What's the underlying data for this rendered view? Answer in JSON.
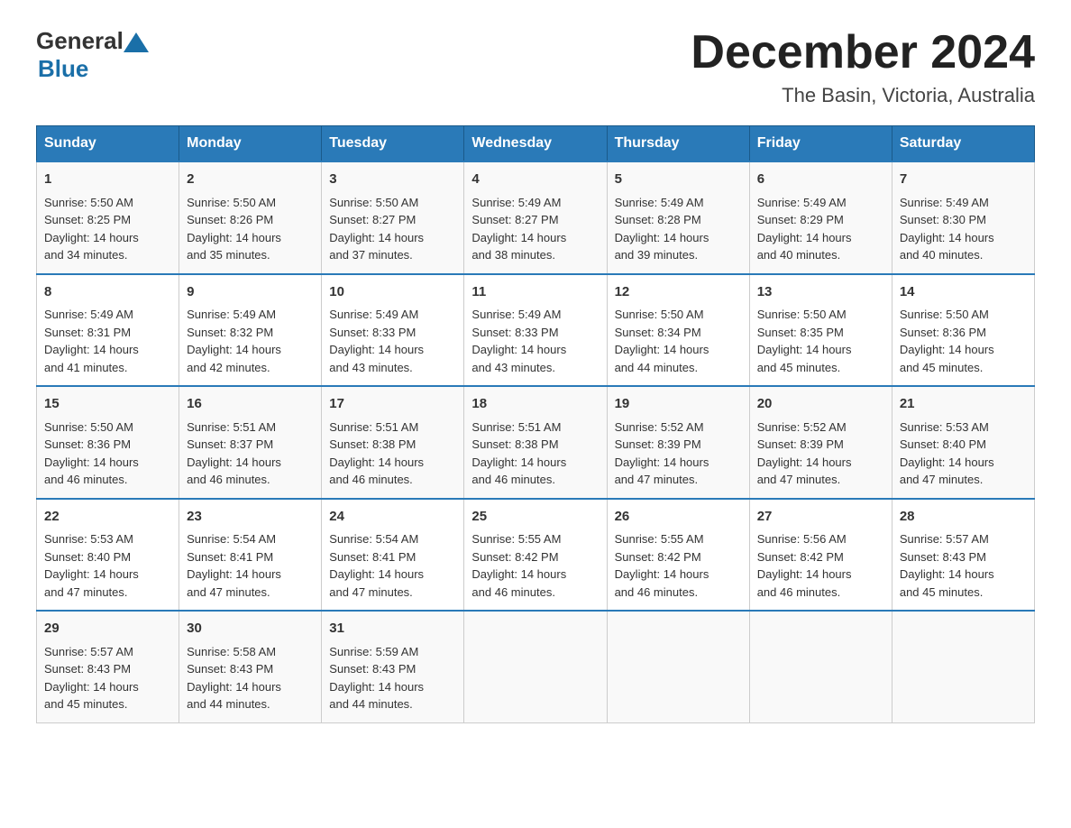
{
  "logo": {
    "general": "General",
    "blue": "Blue"
  },
  "title": {
    "month": "December 2024",
    "location": "The Basin, Victoria, Australia"
  },
  "days_of_week": [
    "Sunday",
    "Monday",
    "Tuesday",
    "Wednesday",
    "Thursday",
    "Friday",
    "Saturday"
  ],
  "weeks": [
    [
      {
        "day": "1",
        "sunrise": "5:50 AM",
        "sunset": "8:25 PM",
        "daylight": "14 hours and 34 minutes."
      },
      {
        "day": "2",
        "sunrise": "5:50 AM",
        "sunset": "8:26 PM",
        "daylight": "14 hours and 35 minutes."
      },
      {
        "day": "3",
        "sunrise": "5:50 AM",
        "sunset": "8:27 PM",
        "daylight": "14 hours and 37 minutes."
      },
      {
        "day": "4",
        "sunrise": "5:49 AM",
        "sunset": "8:27 PM",
        "daylight": "14 hours and 38 minutes."
      },
      {
        "day": "5",
        "sunrise": "5:49 AM",
        "sunset": "8:28 PM",
        "daylight": "14 hours and 39 minutes."
      },
      {
        "day": "6",
        "sunrise": "5:49 AM",
        "sunset": "8:29 PM",
        "daylight": "14 hours and 40 minutes."
      },
      {
        "day": "7",
        "sunrise": "5:49 AM",
        "sunset": "8:30 PM",
        "daylight": "14 hours and 40 minutes."
      }
    ],
    [
      {
        "day": "8",
        "sunrise": "5:49 AM",
        "sunset": "8:31 PM",
        "daylight": "14 hours and 41 minutes."
      },
      {
        "day": "9",
        "sunrise": "5:49 AM",
        "sunset": "8:32 PM",
        "daylight": "14 hours and 42 minutes."
      },
      {
        "day": "10",
        "sunrise": "5:49 AM",
        "sunset": "8:33 PM",
        "daylight": "14 hours and 43 minutes."
      },
      {
        "day": "11",
        "sunrise": "5:49 AM",
        "sunset": "8:33 PM",
        "daylight": "14 hours and 43 minutes."
      },
      {
        "day": "12",
        "sunrise": "5:50 AM",
        "sunset": "8:34 PM",
        "daylight": "14 hours and 44 minutes."
      },
      {
        "day": "13",
        "sunrise": "5:50 AM",
        "sunset": "8:35 PM",
        "daylight": "14 hours and 45 minutes."
      },
      {
        "day": "14",
        "sunrise": "5:50 AM",
        "sunset": "8:36 PM",
        "daylight": "14 hours and 45 minutes."
      }
    ],
    [
      {
        "day": "15",
        "sunrise": "5:50 AM",
        "sunset": "8:36 PM",
        "daylight": "14 hours and 46 minutes."
      },
      {
        "day": "16",
        "sunrise": "5:51 AM",
        "sunset": "8:37 PM",
        "daylight": "14 hours and 46 minutes."
      },
      {
        "day": "17",
        "sunrise": "5:51 AM",
        "sunset": "8:38 PM",
        "daylight": "14 hours and 46 minutes."
      },
      {
        "day": "18",
        "sunrise": "5:51 AM",
        "sunset": "8:38 PM",
        "daylight": "14 hours and 46 minutes."
      },
      {
        "day": "19",
        "sunrise": "5:52 AM",
        "sunset": "8:39 PM",
        "daylight": "14 hours and 47 minutes."
      },
      {
        "day": "20",
        "sunrise": "5:52 AM",
        "sunset": "8:39 PM",
        "daylight": "14 hours and 47 minutes."
      },
      {
        "day": "21",
        "sunrise": "5:53 AM",
        "sunset": "8:40 PM",
        "daylight": "14 hours and 47 minutes."
      }
    ],
    [
      {
        "day": "22",
        "sunrise": "5:53 AM",
        "sunset": "8:40 PM",
        "daylight": "14 hours and 47 minutes."
      },
      {
        "day": "23",
        "sunrise": "5:54 AM",
        "sunset": "8:41 PM",
        "daylight": "14 hours and 47 minutes."
      },
      {
        "day": "24",
        "sunrise": "5:54 AM",
        "sunset": "8:41 PM",
        "daylight": "14 hours and 47 minutes."
      },
      {
        "day": "25",
        "sunrise": "5:55 AM",
        "sunset": "8:42 PM",
        "daylight": "14 hours and 46 minutes."
      },
      {
        "day": "26",
        "sunrise": "5:55 AM",
        "sunset": "8:42 PM",
        "daylight": "14 hours and 46 minutes."
      },
      {
        "day": "27",
        "sunrise": "5:56 AM",
        "sunset": "8:42 PM",
        "daylight": "14 hours and 46 minutes."
      },
      {
        "day": "28",
        "sunrise": "5:57 AM",
        "sunset": "8:43 PM",
        "daylight": "14 hours and 45 minutes."
      }
    ],
    [
      {
        "day": "29",
        "sunrise": "5:57 AM",
        "sunset": "8:43 PM",
        "daylight": "14 hours and 45 minutes."
      },
      {
        "day": "30",
        "sunrise": "5:58 AM",
        "sunset": "8:43 PM",
        "daylight": "14 hours and 44 minutes."
      },
      {
        "day": "31",
        "sunrise": "5:59 AM",
        "sunset": "8:43 PM",
        "daylight": "14 hours and 44 minutes."
      },
      null,
      null,
      null,
      null
    ]
  ],
  "labels": {
    "sunrise": "Sunrise:",
    "sunset": "Sunset:",
    "daylight": "Daylight:"
  }
}
